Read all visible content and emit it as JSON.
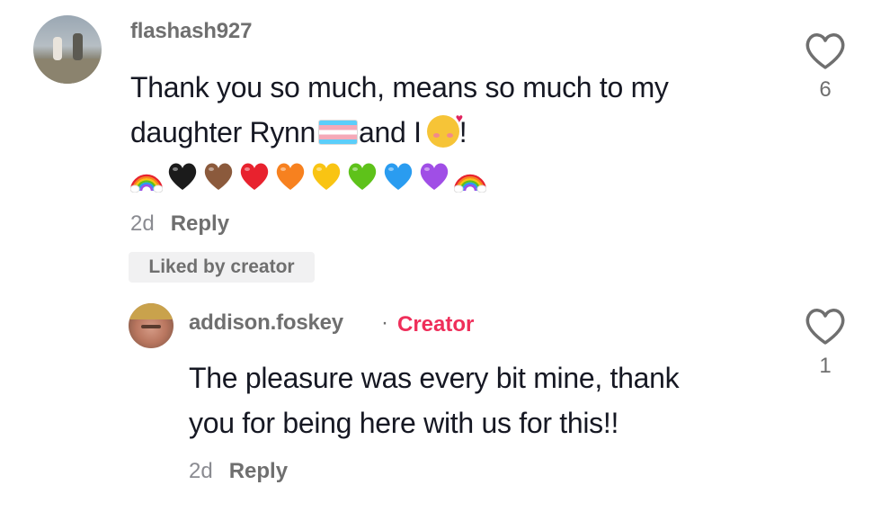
{
  "comments": [
    {
      "username": "flashash927",
      "text_line1": "Thank you so much, means so much to my",
      "text_line2_a": "daughter Rynn",
      "text_line2_b": "and I",
      "text_line2_c": "!",
      "emoji_row": [
        "rainbow",
        "black-heart",
        "brown-heart",
        "red-heart",
        "orange-heart",
        "yellow-heart",
        "green-heart",
        "blue-heart",
        "purple-heart",
        "rainbow"
      ],
      "age": "2d",
      "reply_label": "Reply",
      "liked_badge": "Liked by creator",
      "like_count": "6"
    },
    {
      "username": "addison.foskey",
      "separator": "·",
      "creator_label": "Creator",
      "text_line1": "The pleasure was every bit mine, thank",
      "text_line2": "you for being here with us for this!!",
      "age": "2d",
      "reply_label": "Reply",
      "like_count": "1"
    }
  ],
  "colors": {
    "text_primary": "#161823",
    "text_secondary": "#6f6f6f",
    "creator_accent": "#ef2e5a",
    "badge_bg": "#f1f1f2"
  },
  "heart_colors": {
    "black-heart": "#1b1b1b",
    "brown-heart": "#8b5a3c",
    "red-heart": "#e8222e",
    "orange-heart": "#f7811f",
    "yellow-heart": "#f9c413",
    "green-heart": "#5ec21a",
    "blue-heart": "#2a9cf0",
    "purple-heart": "#a04ee6"
  }
}
